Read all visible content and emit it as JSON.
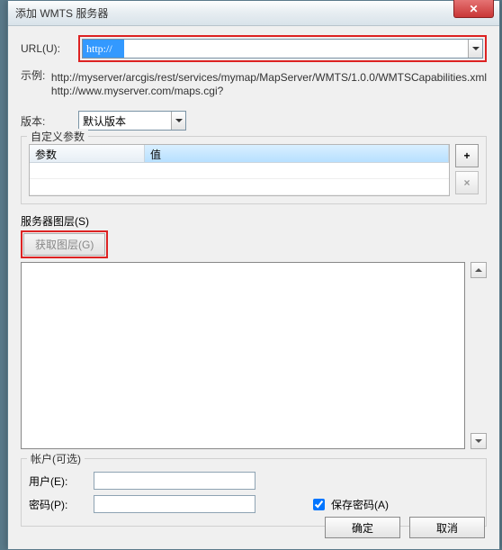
{
  "window": {
    "title": "添加 WMTS 服务器"
  },
  "url": {
    "label": "URL(U):",
    "value": "http://"
  },
  "example": {
    "label": "示例:",
    "line1": "http://myserver/arcgis/rest/services/mymap/MapServer/WMTS/1.0.0/WMTSCapabilities.xml",
    "line2": "http://www.myserver.com/maps.cgi?"
  },
  "version": {
    "label": "版本:",
    "selected": "默认版本"
  },
  "custom_params": {
    "legend": "自定义参数",
    "col_param": "参数",
    "col_value": "值",
    "add_icon": "+",
    "remove_icon": "×"
  },
  "server_layers": {
    "label": "服务器图层(S)",
    "get_layers_btn": "获取图层(G)"
  },
  "account": {
    "legend": "帐户(可选)",
    "user_label": "用户(E):",
    "password_label": "密码(P):",
    "user_value": "",
    "password_value": "",
    "save_password_label": "保存密码(A)",
    "save_password_checked": true
  },
  "buttons": {
    "ok": "确定",
    "cancel": "取消"
  }
}
